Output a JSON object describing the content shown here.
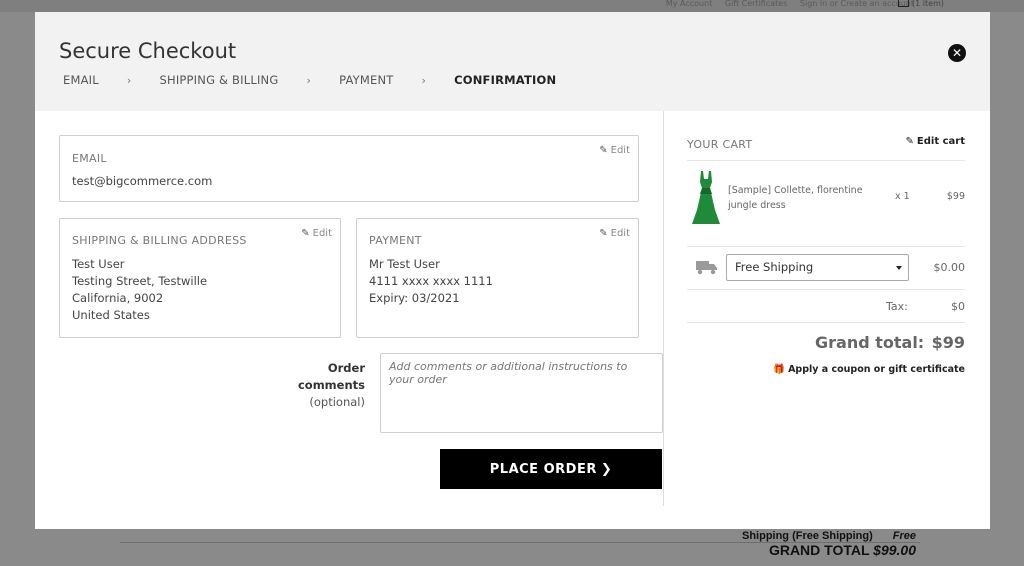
{
  "background": {
    "links": [
      "My Account",
      "Gift Certificates",
      "Sign in or Create an account"
    ],
    "cart_count": "(1 item)",
    "shipping_label": "Shipping (Free Shipping)",
    "shipping_value": "Free",
    "grand_total_label": "GRAND TOTAL",
    "grand_total_value": "$99.00"
  },
  "modal": {
    "title": "Secure Checkout",
    "close_glyph": "✕",
    "steps": [
      "EMAIL",
      "SHIPPING & BILLING",
      "PAYMENT",
      "CONFIRMATION"
    ],
    "active_step": "CONFIRMATION",
    "step_separator": "›"
  },
  "email": {
    "label": "EMAIL",
    "value": "test@bigcommerce.com",
    "edit_label": "Edit"
  },
  "address": {
    "label": "SHIPPING & BILLING ADDRESS",
    "lines": [
      "Test User",
      "Testing Street, Testwille",
      "California, 9002",
      "United States"
    ],
    "edit_label": "Edit"
  },
  "payment": {
    "label": "PAYMENT",
    "lines": [
      "Mr Test User",
      "4111 xxxx xxxx 1111",
      "Expiry: 03/2021"
    ],
    "edit_label": "Edit"
  },
  "comments": {
    "label": "Order comments",
    "optional": "(optional)",
    "placeholder": "Add comments or additional instructions to your order"
  },
  "place_order": {
    "label": "PLACE ORDER",
    "arrow": "❯"
  },
  "cart": {
    "title": "YOUR CART",
    "edit_cart_label": "Edit cart",
    "item": {
      "name": "[Sample] Collette, florentine jungle dress",
      "qty": "x 1",
      "price": "$99"
    },
    "shipping": {
      "selected": "Free Shipping",
      "price": "$0.00"
    },
    "tax_label": "Tax:",
    "tax_value": "$0",
    "grand_total_label": "Grand total:",
    "grand_total_value": "$99",
    "coupon_label": "Apply a coupon or gift certificate"
  },
  "colors": {
    "button_bg": "#000000",
    "dress_green": "#1e8a3a",
    "header_bg": "#f2f2f2"
  }
}
